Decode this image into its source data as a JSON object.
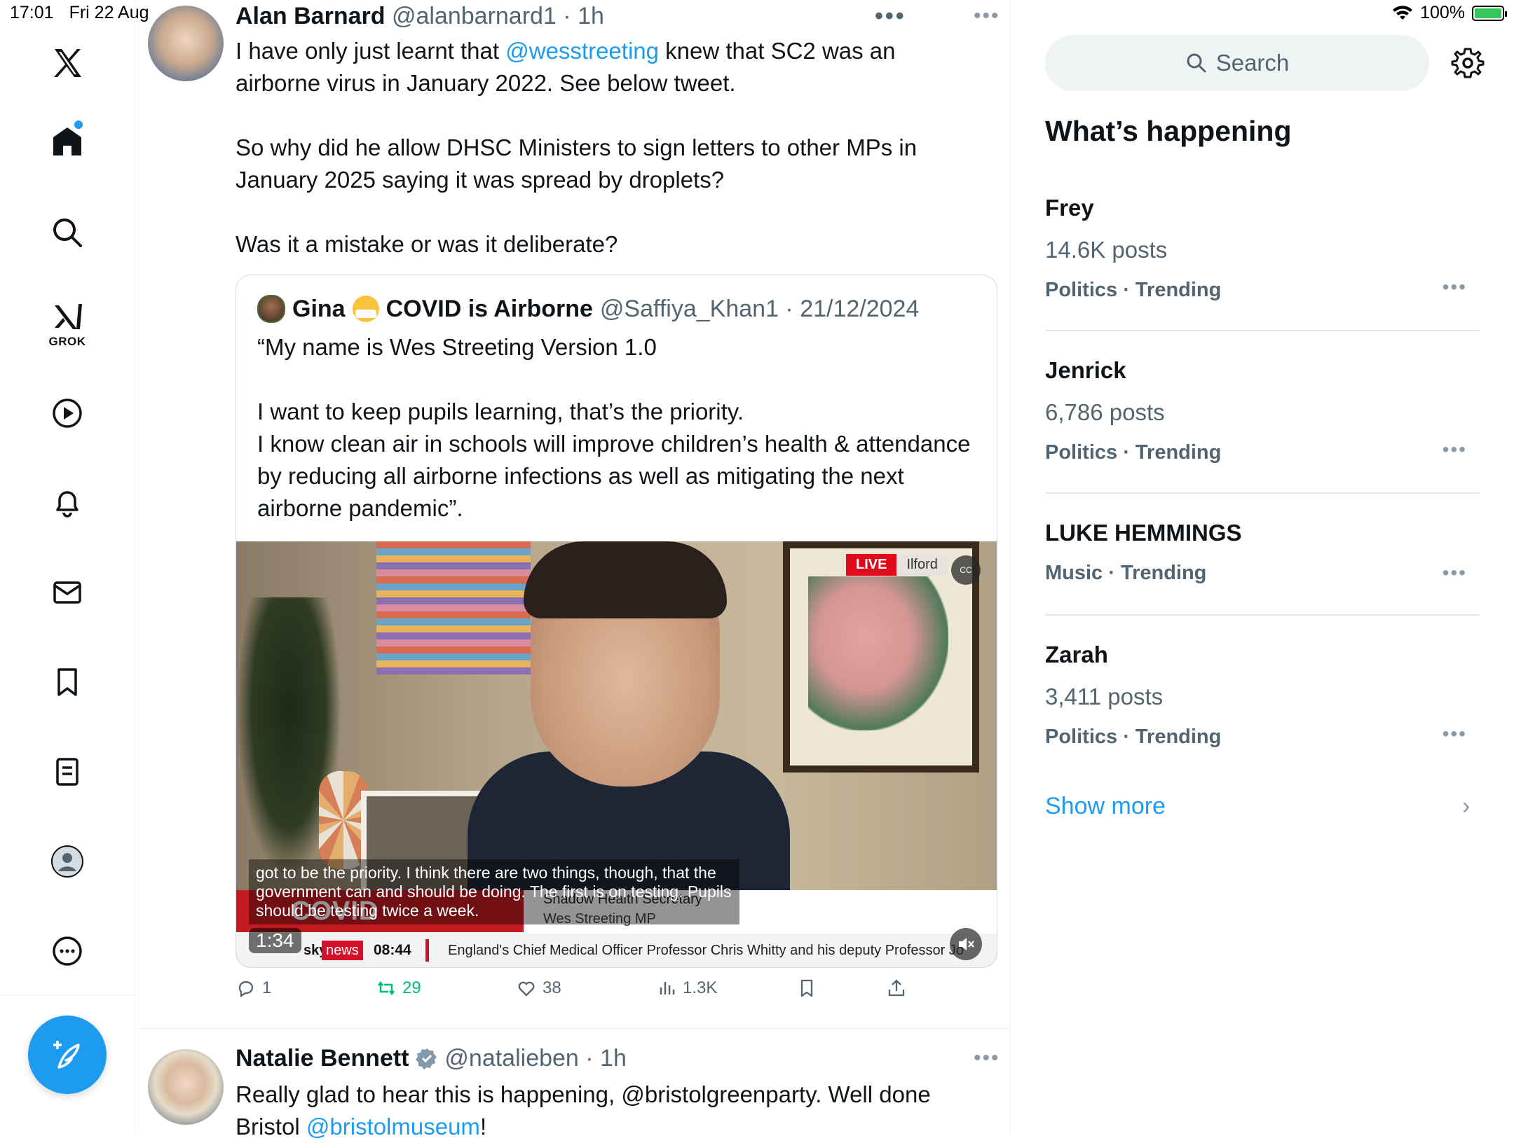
{
  "status_bar": {
    "time": "17:01",
    "date": "Fri 22 Aug",
    "battery": "100%"
  },
  "nav": {
    "grok_label": "GROK",
    "items": [
      "x-logo",
      "home",
      "search",
      "grok",
      "video",
      "notifications",
      "messages",
      "bookmarks",
      "lists",
      "profile",
      "more"
    ]
  },
  "post1": {
    "name": "Alan Barnard",
    "handle_time": "@alanbarnard1 · 1h",
    "line1_pre": "I have only just learnt that ",
    "mention": "@wesstreeting",
    "line1_post": " knew that SC2 was an airborne virus in January 2022. See below tweet.",
    "para2": "So why did he allow DHSC Ministers to sign letters to other MPs in January 2025 saying it was spread by droplets?",
    "para3": "Was it a mistake or was it deliberate?",
    "quote": {
      "name_prefix": "Gina",
      "name_suffix": "COVID is Airborne",
      "handle_date": "@Saffiya_Khan1 · 21/12/2024",
      "para1": "“My name is Wes Streeting Version 1.0",
      "para2_line1": "I want to keep pupils learning, that’s the priority.",
      "para2_line2": "I know clean air in schools will improve children’s health & attendance by reducing all airborne infections as well as mitigating the next airborne pandemic”.",
      "video": {
        "live": "LIVE",
        "location": "Ilford",
        "cc": "CC",
        "subtitle": "got to be the priority. I think there are two things, though, that the government can and should be doing. The first is on testing. Pupils should be testing twice a week.",
        "banner": "COVID RESTRICTIONS",
        "role": "Shadow Health Secretary",
        "person": "Wes Streeting MP",
        "duration": "1:34",
        "sky": "sky",
        "news": "news",
        "ticker_time": "08:44",
        "ticker_text": "England's Chief Medical Officer Professor Chris Whitty and his deputy Professor Jo"
      }
    },
    "actions": {
      "replies": "1",
      "reposts": "29",
      "likes": "38",
      "views": "1.3K"
    }
  },
  "post2": {
    "name": "Natalie Bennett",
    "handle_time": "@natalieben · 1h",
    "text_pre": "Really glad to hear this is happening, @bristolgreenparty. Well done Bristol ",
    "mention": "@bristolmuseum",
    "text_post": "!"
  },
  "sidebar": {
    "search_placeholder": "Search",
    "title": "What’s happening",
    "trends": [
      {
        "name": "Frey",
        "posts": "14.6K posts",
        "category": "Politics · Trending"
      },
      {
        "name": "Jenrick",
        "posts": "6,786 posts",
        "category": "Politics · Trending"
      },
      {
        "name": "LUKE HEMMINGS",
        "posts": "",
        "category": "Music · Trending"
      },
      {
        "name": "Zarah",
        "posts": "3,411 posts",
        "category": "Politics · Trending"
      }
    ],
    "show_more": "Show more"
  },
  "colors": {
    "accent": "#1d9bf0",
    "text": "#0f1419",
    "muted": "#536471",
    "repost_green": "#00ba7c"
  }
}
